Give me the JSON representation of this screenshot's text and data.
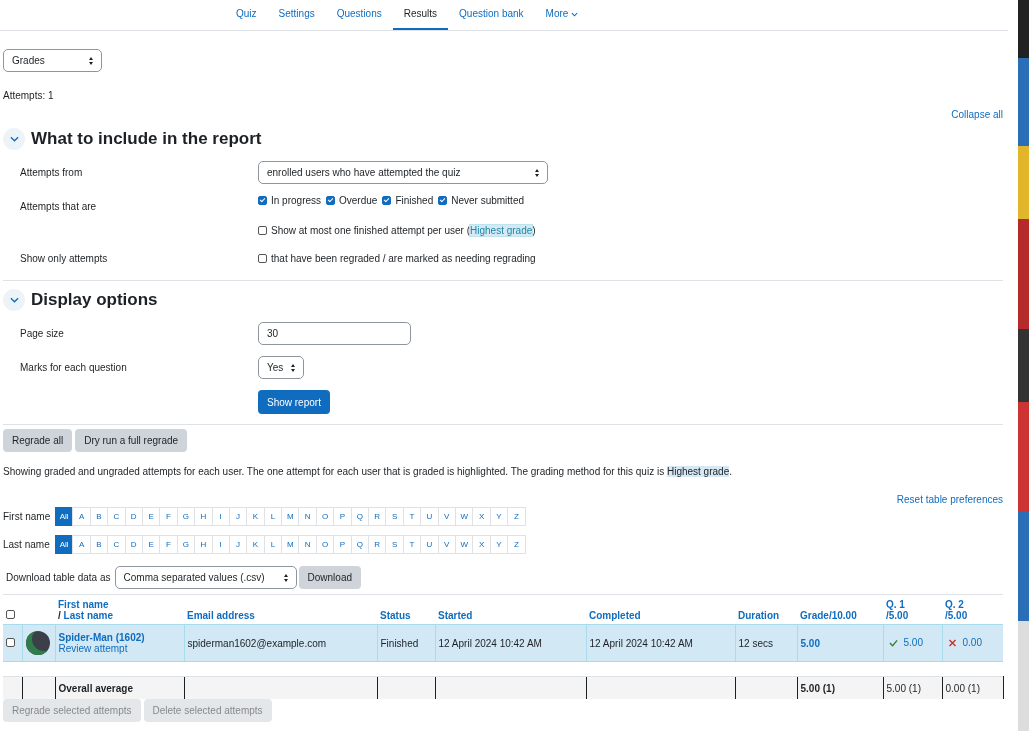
{
  "nav": {
    "tabs": [
      {
        "label": "Quiz",
        "selected": false
      },
      {
        "label": "Settings",
        "selected": false
      },
      {
        "label": "Questions",
        "selected": false
      },
      {
        "label": "Results",
        "selected": true
      },
      {
        "label": "Question bank",
        "selected": false
      },
      {
        "label": "More",
        "selected": false,
        "kind": "menu"
      }
    ]
  },
  "report_select": "Grades",
  "attempts_count": "Attempts: 1",
  "collapse_all": "Collapse all",
  "include_section": {
    "title": "What to include in the report",
    "expanded": true,
    "attempts_from": {
      "label": "Attempts from",
      "value": "enrolled users who have attempted the quiz"
    },
    "attempts_that_are": {
      "label": "Attempts that are",
      "options": [
        {
          "label": "In progress",
          "checked": true
        },
        {
          "label": "Overdue",
          "checked": true
        },
        {
          "label": "Finished",
          "checked": true
        },
        {
          "label": "Never submitted",
          "checked": true
        }
      ],
      "one_attempt": {
        "checked": false,
        "label": "Show at most one finished attempt per user (",
        "highlight": "Highest grade",
        "after": ")"
      }
    },
    "show_only": {
      "label": "Show only attempts",
      "option": {
        "label": "that have been regraded / are marked as needing regrading",
        "checked": false
      }
    }
  },
  "display_section": {
    "title": "Display options",
    "expanded": true,
    "page_size": {
      "label": "Page size",
      "value": "30"
    },
    "marks": {
      "label": "Marks for each question",
      "value": "Yes"
    },
    "submit": "Show report"
  },
  "regrade_buttons": [
    "Regrade all",
    "Dry run a full regrade"
  ],
  "info": {
    "text": "Showing graded and ungraded attempts for each user. The one attempt for each user that is graded is highlighted. The grading method for this quiz is ",
    "highlight": "Highest grade",
    "after": "."
  },
  "reset_link": "Reset table preferences",
  "initials_bars": [
    {
      "label": "First name",
      "letters": [
        {
          "label": "All",
          "selected": true
        },
        {
          "label": "A",
          "selected": false
        },
        {
          "label": "B",
          "selected": false
        },
        {
          "label": "C",
          "selected": false
        },
        {
          "label": "D",
          "selected": false
        },
        {
          "label": "E",
          "selected": false
        },
        {
          "label": "F",
          "selected": false
        },
        {
          "label": "G",
          "selected": false
        },
        {
          "label": "H",
          "selected": false
        },
        {
          "label": "I",
          "selected": false
        },
        {
          "label": "J",
          "selected": false
        },
        {
          "label": "K",
          "selected": false
        },
        {
          "label": "L",
          "selected": false
        },
        {
          "label": "M",
          "selected": false
        },
        {
          "label": "N",
          "selected": false
        },
        {
          "label": "O",
          "selected": false
        },
        {
          "label": "P",
          "selected": false
        },
        {
          "label": "Q",
          "selected": false
        },
        {
          "label": "R",
          "selected": false
        },
        {
          "label": "S",
          "selected": false
        },
        {
          "label": "T",
          "selected": false
        },
        {
          "label": "U",
          "selected": false
        },
        {
          "label": "V",
          "selected": false
        },
        {
          "label": "W",
          "selected": false
        },
        {
          "label": "X",
          "selected": false
        },
        {
          "label": "Y",
          "selected": false
        },
        {
          "label": "Z",
          "selected": false
        }
      ]
    },
    {
      "label": "Last name",
      "letters": [
        {
          "label": "All",
          "selected": true
        },
        {
          "label": "A",
          "selected": false
        },
        {
          "label": "B",
          "selected": false
        },
        {
          "label": "C",
          "selected": false
        },
        {
          "label": "D",
          "selected": false
        },
        {
          "label": "E",
          "selected": false
        },
        {
          "label": "F",
          "selected": false
        },
        {
          "label": "G",
          "selected": false
        },
        {
          "label": "H",
          "selected": false
        },
        {
          "label": "I",
          "selected": false
        },
        {
          "label": "J",
          "selected": false
        },
        {
          "label": "K",
          "selected": false
        },
        {
          "label": "L",
          "selected": false
        },
        {
          "label": "M",
          "selected": false
        },
        {
          "label": "N",
          "selected": false
        },
        {
          "label": "O",
          "selected": false
        },
        {
          "label": "P",
          "selected": false
        },
        {
          "label": "Q",
          "selected": false
        },
        {
          "label": "R",
          "selected": false
        },
        {
          "label": "S",
          "selected": false
        },
        {
          "label": "T",
          "selected": false
        },
        {
          "label": "U",
          "selected": false
        },
        {
          "label": "V",
          "selected": false
        },
        {
          "label": "W",
          "selected": false
        },
        {
          "label": "X",
          "selected": false
        },
        {
          "label": "Y",
          "selected": false
        },
        {
          "label": "Z",
          "selected": false
        }
      ]
    }
  ],
  "download": {
    "label": "Download table data as",
    "format": "Comma separated values (.csv)",
    "button": "Download"
  },
  "table": {
    "select_all_checked": false,
    "name_header": {
      "first": "First name",
      "separator": "/ ",
      "last": "Last name"
    },
    "columns": [
      {
        "label": "Email address"
      },
      {
        "label": "Status"
      },
      {
        "label": "Started"
      },
      {
        "label": "Completed"
      },
      {
        "label": "Duration"
      },
      {
        "label": "Grade/10.00"
      },
      {
        "label": "Q. 1",
        "sub": "/5.00"
      },
      {
        "label": "Q. 2",
        "sub": "/5.00"
      }
    ],
    "rows": [
      {
        "selected": true,
        "checked": false,
        "name": "Spider-Man (1602)",
        "review": "Review attempt",
        "email": "spiderman1602@example.com",
        "status": "Finished",
        "started": "12 April 2024 10:42 AM",
        "completed": "12 April 2024 10:42 AM",
        "duration": "12 secs",
        "grade": "5.00",
        "questions": [
          {
            "value": "5.00",
            "kind": "correct"
          },
          {
            "value": "0.00",
            "kind": "incorrect"
          }
        ]
      }
    ],
    "average": {
      "label": "Overall average",
      "grade": "5.00 (1)",
      "questions": [
        "5.00 (1)",
        "0.00 (1)"
      ]
    }
  },
  "bottom_buttons": [
    {
      "label": "Regrade selected attempts",
      "disabled": true
    },
    {
      "label": "Delete selected attempts",
      "disabled": true
    }
  ]
}
